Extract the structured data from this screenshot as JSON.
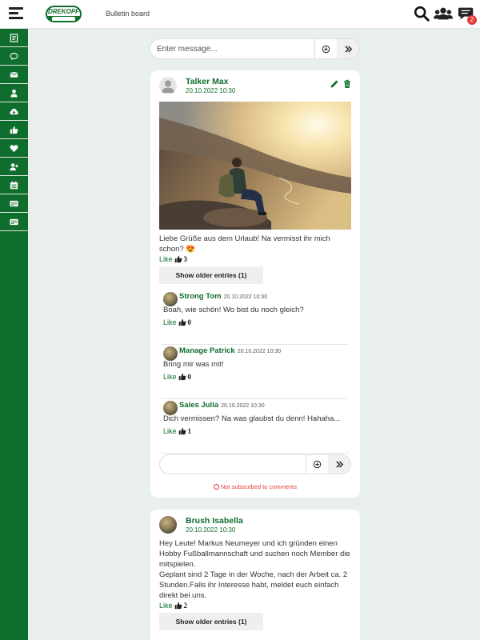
{
  "header": {
    "logo_text": "DREKOPF",
    "page_title": "Bulletin board",
    "chat_badge": "2",
    "icons": [
      "menu-icon",
      "search-icon",
      "users-icon",
      "chat-icon"
    ]
  },
  "sidebar": {
    "items": [
      {
        "icon": "document-icon"
      },
      {
        "icon": "speech-bubble-icon"
      },
      {
        "icon": "envelope-icon"
      },
      {
        "icon": "user-icon"
      },
      {
        "icon": "cloud-download-icon"
      },
      {
        "icon": "thumbs-up-icon"
      },
      {
        "icon": "heart-icon"
      },
      {
        "icon": "user-plus-icon"
      },
      {
        "icon": "calendar-icon"
      },
      {
        "icon": "card-icon"
      },
      {
        "icon": "card-icon"
      }
    ]
  },
  "composer": {
    "placeholder": "Enter message..."
  },
  "posts": [
    {
      "author": "Talker Max",
      "date": "20.10.2022 10:30",
      "text_line1": "Liebe Grüße aus dem Urlaub! Na vermisst ihr mich",
      "text_line2": "schon? 😍",
      "like_label": "Like",
      "like_count": "3",
      "older_label": "Show older entries (1)",
      "comments": [
        {
          "author": "Strong Tom",
          "date": "20.10.2022 10:30",
          "text": "Boah, wie schön! Wo bist du noch gleich?",
          "like_label": "Like",
          "like_count": "0"
        },
        {
          "author": "Manage Patrick",
          "date": "20.10.2022 10:30",
          "text": "Bring mir was mit!",
          "like_label": "Like",
          "like_count": "0"
        },
        {
          "author": "Sales Julia",
          "date": "20.10.2022 10:30",
          "text": "Dich vermissen? Na was glaubst du denn! Hahaha...",
          "like_label": "Like",
          "like_count": "1"
        }
      ],
      "subscribe_note": "Not subscribed to comments"
    },
    {
      "author": "Brush Isabella",
      "date": "20.10.2022 10:30",
      "text_lines": [
        "Hey Leute! Markus Neumeyer und ich gründen einen",
        "Hobby Fußballmannschaft und suchen noch Member die",
        "mitspielen.",
        "Geplant sind 2 Tage in der Woche, nach der Arbeit ca. 2",
        "Stunden.Falls ihr Interesse habt, meldet euch einfach",
        "direkt bei uns."
      ],
      "like_label": "Like",
      "like_count": "2",
      "older_label": "Show older entries (1)"
    }
  ],
  "colors": {
    "brand_green": "#0f6e2d",
    "background": "#e9efec",
    "badge_red": "#e53935"
  }
}
